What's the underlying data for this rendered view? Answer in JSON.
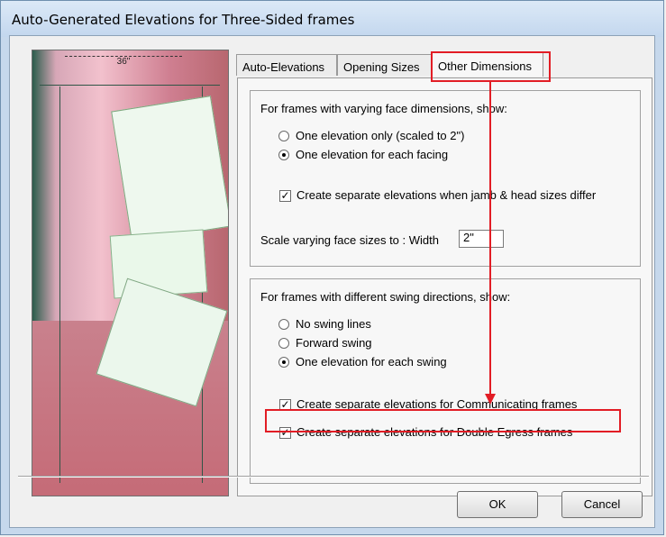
{
  "window": {
    "title": "Auto-Generated Elevations for Three-Sided frames"
  },
  "tabs": [
    {
      "label": "Auto-Elevations",
      "active": false
    },
    {
      "label": "Opening Sizes",
      "active": false
    },
    {
      "label": "Other Dimensions",
      "active": true
    }
  ],
  "face_group": {
    "heading": "For frames with varying face dimensions, show:",
    "options": [
      {
        "label": "One elevation only  (scaled to 2\")",
        "selected": false
      },
      {
        "label": "One elevation for each facing",
        "selected": true
      }
    ],
    "checkbox": {
      "label": "Create separate elevations when jamb & head sizes differ",
      "checked": true
    },
    "scale_label": "Scale varying face sizes to :  Width",
    "scale_value": "2\""
  },
  "swing_group": {
    "heading": "For frames with different swing directions, show:",
    "options": [
      {
        "label": "No swing lines",
        "selected": false
      },
      {
        "label": "Forward swing",
        "selected": false
      },
      {
        "label": "One elevation for each swing",
        "selected": true
      }
    ],
    "checkboxes": [
      {
        "label": "Create separate elevations for Communicating frames",
        "checked": true
      },
      {
        "label": "Create separate elevations for Double Egress frames",
        "checked": true
      }
    ]
  },
  "buttons": {
    "ok": "OK",
    "cancel": "Cancel"
  },
  "preview": {
    "dimension_label": "36\""
  },
  "colors": {
    "highlight": "#e21d25",
    "window_frame": "#c6d8ec"
  }
}
